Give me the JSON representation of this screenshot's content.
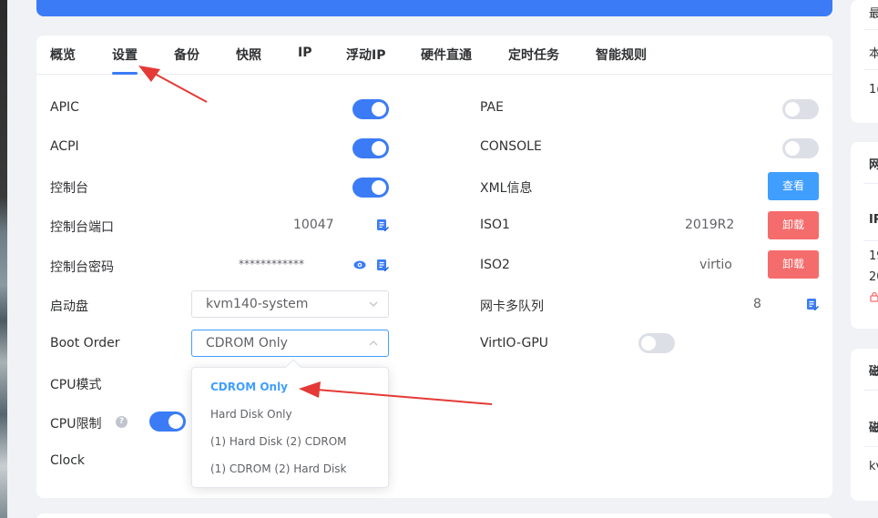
{
  "tabs": [
    {
      "label": "概览"
    },
    {
      "label": "设置"
    },
    {
      "label": "备份"
    },
    {
      "label": "快照"
    },
    {
      "label": "IP"
    },
    {
      "label": "浮动IP"
    },
    {
      "label": "硬件直通"
    },
    {
      "label": "定时任务"
    },
    {
      "label": "智能规则"
    }
  ],
  "active_tab": "设置",
  "left": {
    "apic": {
      "label": "APIC",
      "on": true
    },
    "acpi": {
      "label": "ACPI",
      "on": true
    },
    "console": {
      "label": "控制台",
      "on": true
    },
    "console_port": {
      "label": "控制台端口",
      "value": "10047"
    },
    "console_password": {
      "label": "控制台密码",
      "value": "************"
    },
    "boot_disk": {
      "label": "启动盘",
      "value": "kvm140-system"
    },
    "boot_order": {
      "label": "Boot Order",
      "value": "CDROM Only"
    },
    "cpu_mode": {
      "label": "CPU模式"
    },
    "cpu_limit": {
      "label": "CPU限制",
      "help": "?",
      "on": true
    },
    "clock": {
      "label": "Clock"
    }
  },
  "right": {
    "pae": {
      "label": "PAE",
      "on": false
    },
    "console2": {
      "label": "CONSOLE",
      "on": false
    },
    "xml": {
      "label": "XML信息",
      "button": "查看"
    },
    "iso1": {
      "label": "ISO1",
      "value": "2019R2",
      "button": "卸载"
    },
    "iso2": {
      "label": "ISO2",
      "value": "virtio",
      "button": "卸载"
    },
    "nic_queue": {
      "label": "网卡多队列",
      "value": "8"
    },
    "virtio_gpu": {
      "label": "VirtIO-GPU",
      "on": false
    }
  },
  "boot_order_options": [
    {
      "label": "CDROM Only",
      "selected": true
    },
    {
      "label": "Hard Disk Only",
      "selected": false
    },
    {
      "label": "(1) Hard Disk (2) CDROM",
      "selected": false
    },
    {
      "label": "(1) CDROM (2) Hard Disk",
      "selected": false
    }
  ],
  "side_panel": {
    "top_items": [
      "最",
      "本",
      "1("
    ],
    "net_title": "网",
    "net_items": [
      "IP",
      "19",
      "20"
    ],
    "disk_title": "磁",
    "disk_items": [
      "磁",
      "kv"
    ]
  },
  "colors": {
    "primary": "#3b7cf6",
    "danger": "#f56c6c",
    "info": "#409eff",
    "annotation": "#e53935"
  }
}
